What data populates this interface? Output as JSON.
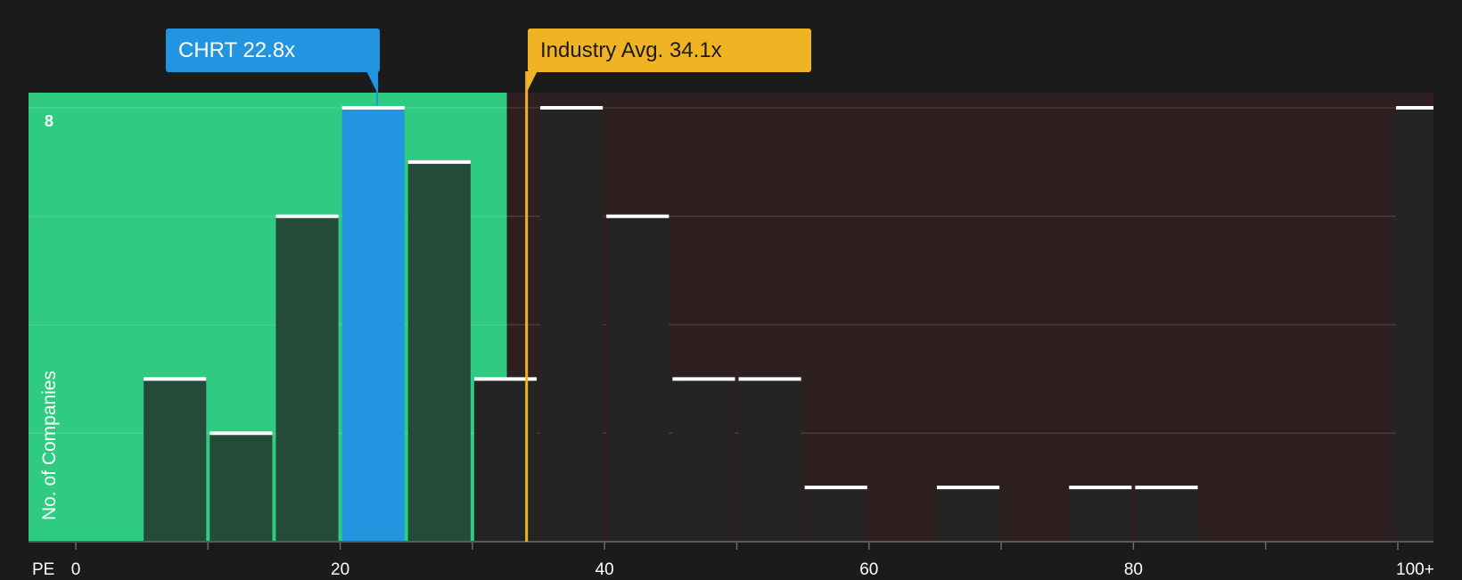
{
  "company_label": "CHRT 22.8x",
  "industry_label": "Industry Avg. 34.1x",
  "chart_data": {
    "type": "bar",
    "xlabel": "PE",
    "ylabel": "No. of Companies",
    "x_ticks": [
      "0",
      "20",
      "40",
      "60",
      "80",
      "100+"
    ],
    "y_ticks": [
      "8"
    ],
    "ylim": [
      0,
      8
    ],
    "bin_width": 5,
    "bins": [
      {
        "start": 5,
        "count": 3
      },
      {
        "start": 10,
        "count": 2
      },
      {
        "start": 15,
        "count": 6
      },
      {
        "start": 20,
        "count": 8,
        "highlight": true
      },
      {
        "start": 25,
        "count": 7
      },
      {
        "start": 30,
        "count": 3
      },
      {
        "start": 35,
        "count": 8
      },
      {
        "start": 40,
        "count": 6
      },
      {
        "start": 45,
        "count": 3
      },
      {
        "start": 50,
        "count": 3
      },
      {
        "start": 55,
        "count": 1
      },
      {
        "start": 65,
        "count": 1
      },
      {
        "start": 75,
        "count": 1
      },
      {
        "start": 80,
        "count": 1
      },
      {
        "start": 100,
        "count": 8
      }
    ],
    "company_pe": 22.8,
    "industry_avg_pe": 34.1,
    "undervalued_region_end": 34.1,
    "colors": {
      "background": "#1b1b1b",
      "undervalued_zone": "#2ecb81",
      "overvalued_zone": "#2e1f20",
      "company": "#2394e0",
      "industry": "#f0b323",
      "bar_green": "#244b39",
      "bar_dark": "#242424",
      "cap": "#ffffff"
    }
  }
}
